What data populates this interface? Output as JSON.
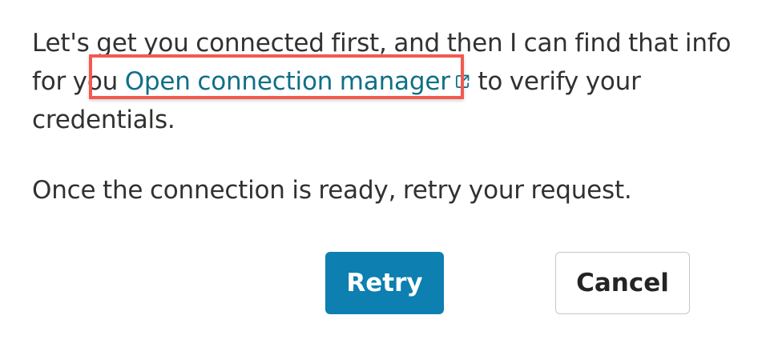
{
  "message": {
    "line1_before_link": "Let's get you connected first, and then I can find that info for you",
    "link_label": "Open connection manager",
    "link_icon": "external-link-icon",
    "after_link": "to verify your credentials.",
    "second_paragraph": "Once the connection is ready, retry your request."
  },
  "buttons": {
    "retry_label": "Retry",
    "cancel_label": "Cancel"
  },
  "colors": {
    "link": "#0f6f87",
    "primary_button": "#0d7fb0",
    "highlight": "#f25a50"
  }
}
